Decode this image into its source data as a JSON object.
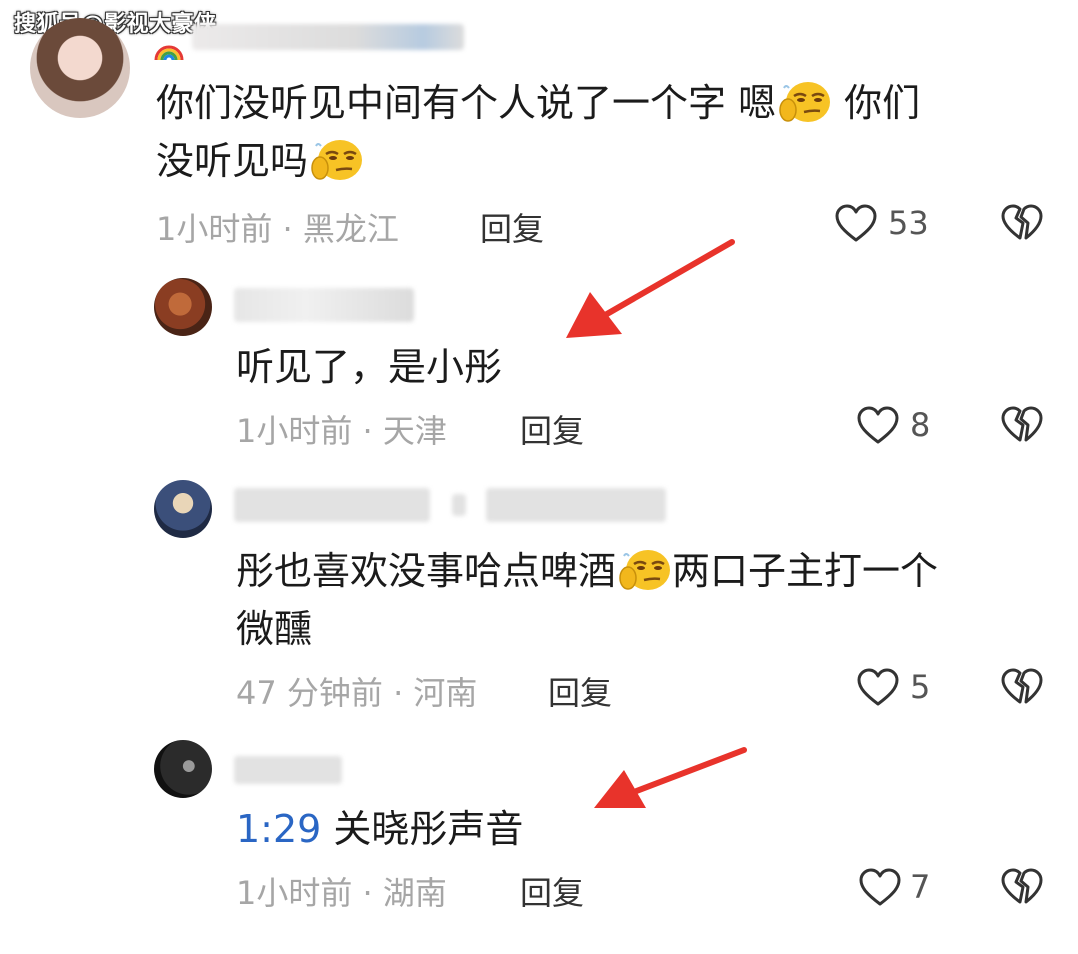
{
  "watermark": "搜狐号@影视大豪侠",
  "comments": [
    {
      "text_line1": "你们没听见中间有个人说了一个字 嗯",
      "text_after_emoji": " 你们",
      "text_line2": "没听见吗",
      "time": "1小时前 · 黑龙江",
      "reply": "回复",
      "likes": "53"
    },
    {
      "text_line1": "听见了，是小彤",
      "time": "1小时前 · 天津",
      "reply": "回复",
      "likes": "8"
    },
    {
      "text_line1": "彤也喜欢没事哈点啤酒",
      "text_after_emoji": "两口子主打一个",
      "text_line2": "微醺",
      "time": "47 分钟前 · 河南",
      "reply": "回复",
      "likes": "5"
    },
    {
      "timestamp": "1:29",
      "text_line1": " 关晓彤声音",
      "time": "1小时前 · 湖南",
      "reply": "回复",
      "likes": "7"
    }
  ],
  "icons": {
    "like": "heart-outline-icon",
    "dislike": "broken-heart-icon",
    "emoji": "thinking-face-emoji"
  },
  "colors": {
    "arrow": "#e8332b",
    "timestamp_link": "#2a66c4",
    "meta_gray": "#a6a6a6"
  }
}
